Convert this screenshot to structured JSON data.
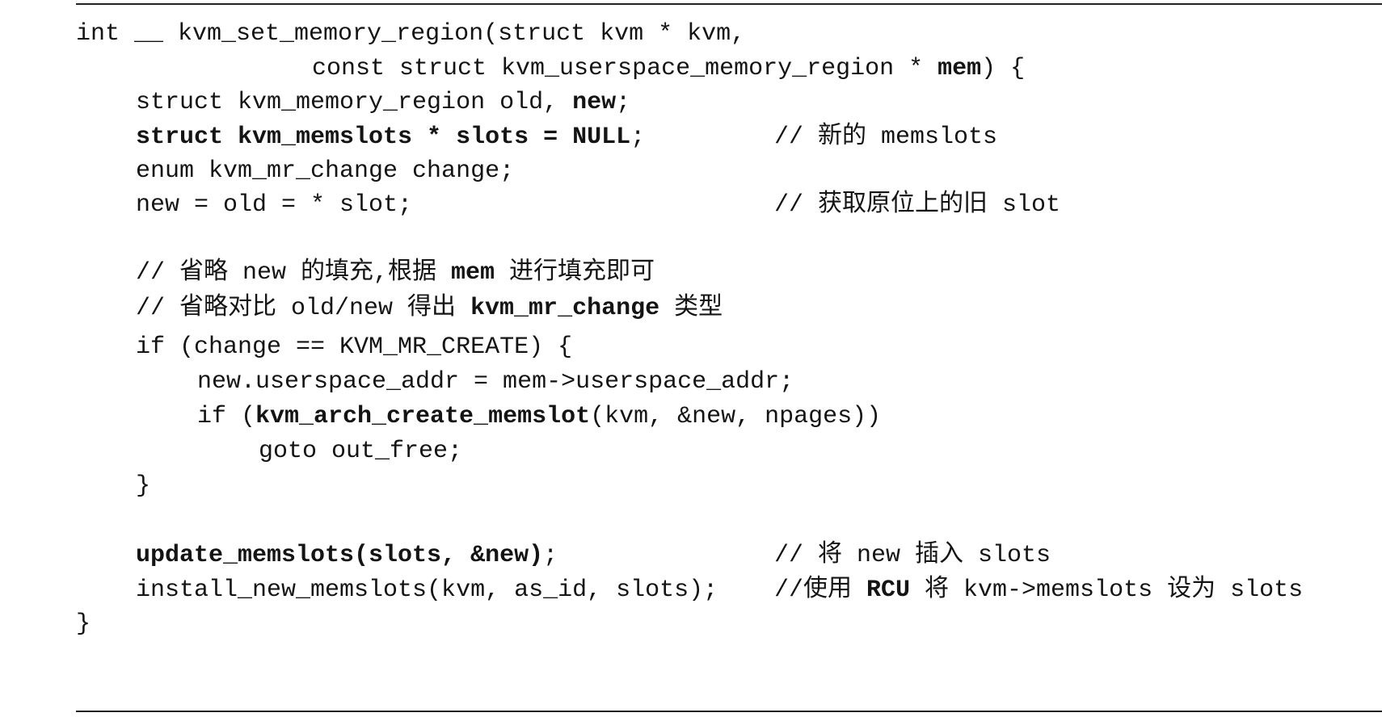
{
  "lines": {
    "l1": "int __ kvm_set_memory_region(struct kvm * kvm,",
    "l2a": "const struct kvm_userspace_memory_region * ",
    "l2b": "mem",
    "l2c": ") {",
    "l3a": "struct kvm_memory_region old, ",
    "l3b": "new",
    "l3c": ";",
    "l4a": "struct kvm_memslots * slots = NULL",
    "l4b": ";",
    "l4comment": "// 新的 memslots",
    "l5": "enum kvm_mr_change change;",
    "l6": "new = old = * slot;",
    "l6comment": "// 获取原位上的旧 slot",
    "l7a": "// 省略 new 的填充,根据 ",
    "l7b": "mem",
    "l7c": " 进行填充即可",
    "l8a": "// 省略对比 old/new 得出 ",
    "l8b": "kvm_mr_change",
    "l8c": " 类型",
    "l9": "if (change == KVM_MR_CREATE) {",
    "l10": "new.userspace_addr = mem->userspace_addr;",
    "l11a": "if (",
    "l11b": "kvm_arch_create_memslot",
    "l11c": "(kvm, &new, npages))",
    "l12": "goto out_free;",
    "l13": "}",
    "l14a": "update_memslots(slots, &new)",
    "l14b": ";",
    "l14comment": "// 将 new 插入 slots",
    "l15": "install_new_memslots(kvm, as_id, slots);",
    "l15comment_a": "//使用 ",
    "l15comment_b": "RCU",
    "l15comment_c": " 将 kvm->memslots 设为 slots",
    "l16": "}"
  }
}
